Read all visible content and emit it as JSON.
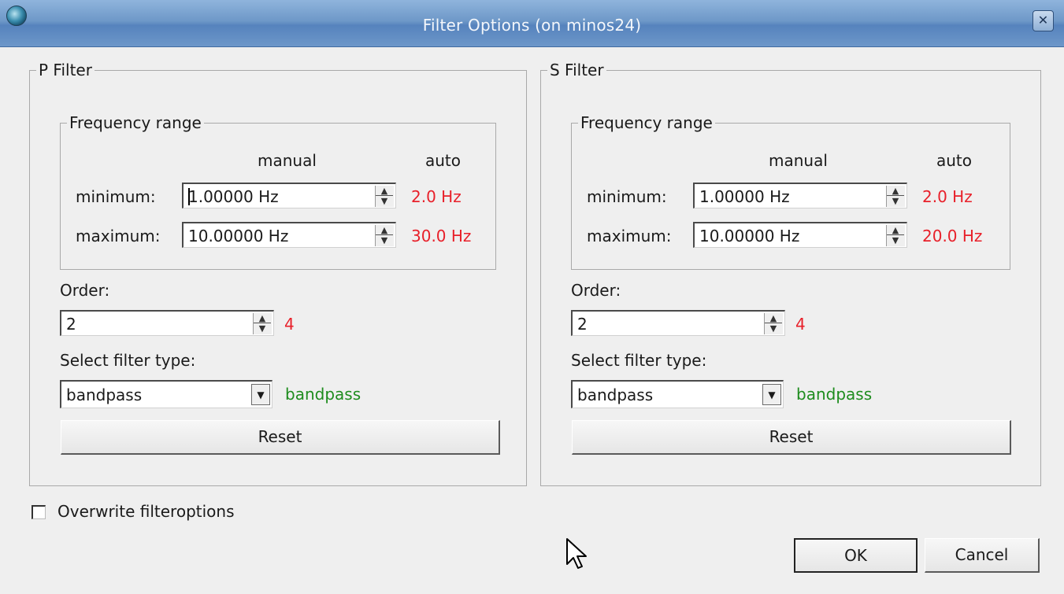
{
  "window": {
    "title": "Filter Options (on minos24)",
    "close_glyph": "✕"
  },
  "p_filter": {
    "title": "P Filter",
    "freq_title": "Frequency range",
    "col_manual": "manual",
    "col_auto": "auto",
    "min_label": "minimum:",
    "min_value": "1.00000 Hz",
    "min_auto": "2.0 Hz",
    "max_label": "maximum:",
    "max_value": "10.00000 Hz",
    "max_auto": "30.0 Hz",
    "order_label": "Order:",
    "order_value": "2",
    "order_auto": "4",
    "type_label": "Select filter type:",
    "type_value": "bandpass",
    "type_auto": "bandpass",
    "reset_label": "Reset"
  },
  "s_filter": {
    "title": "S Filter",
    "freq_title": "Frequency range",
    "col_manual": "manual",
    "col_auto": "auto",
    "min_label": "minimum:",
    "min_value": "1.00000 Hz",
    "min_auto": "2.0 Hz",
    "max_label": "maximum:",
    "max_value": "10.00000 Hz",
    "max_auto": "20.0 Hz",
    "order_label": "Order:",
    "order_value": "2",
    "order_auto": "4",
    "type_label": "Select filter type:",
    "type_value": "bandpass",
    "type_auto": "bandpass",
    "reset_label": "Reset"
  },
  "overwrite_label": "Overwrite filteroptions",
  "overwrite_checked": false,
  "ok_label": "OK",
  "cancel_label": "Cancel",
  "colors": {
    "auto_value": "#e8202a",
    "auto_type": "#1e8c1e",
    "titlebar": "#6e98c8"
  }
}
